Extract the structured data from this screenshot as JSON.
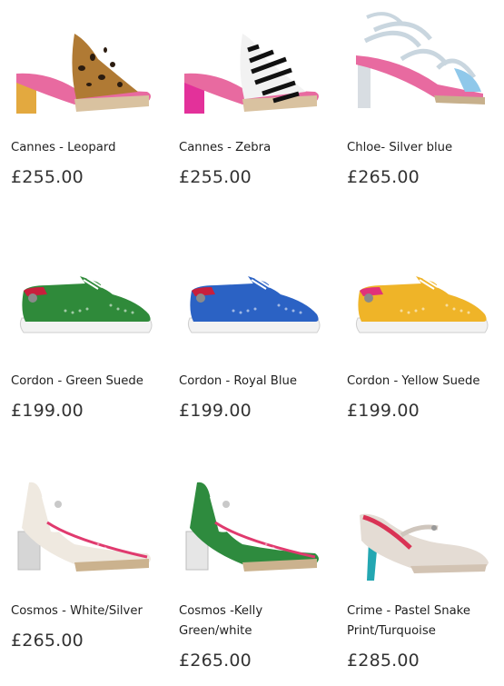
{
  "products": [
    {
      "name": "Cannes - Leopard",
      "price": "£255.00",
      "style": "mule-leopard",
      "colors": {
        "upper": "#b07a34",
        "spots": "#2b1c10",
        "heel": "#e0a02a",
        "lining": "#e86aa0",
        "sole": "#d9c2a0"
      }
    },
    {
      "name": "Cannes - Zebra",
      "price": "£255.00",
      "style": "mule-zebra",
      "colors": {
        "upper": "#f2f2f2",
        "stripes": "#111111",
        "heel": "#e01b8f",
        "lining": "#e86aa0",
        "sole": "#d9c2a0"
      }
    },
    {
      "name": "Chloe- Silver blue",
      "price": "£265.00",
      "style": "strappy-heel",
      "colors": {
        "upper": "#c9d6df",
        "accent": "#8fc8ea",
        "heel": "#d8dde2",
        "lining": "#e86aa0",
        "sole": "#c7b08c"
      }
    },
    {
      "name": "Cordon - Green Suede",
      "price": "£199.00",
      "style": "brogue",
      "colors": {
        "upper": "#2f8a3a",
        "sole": "#f2f2f2",
        "lining": "#c81f3c",
        "laces": "#ffffff"
      }
    },
    {
      "name": "Cordon - Royal Blue",
      "price": "£199.00",
      "style": "brogue",
      "colors": {
        "upper": "#2b62c4",
        "sole": "#f2f2f2",
        "lining": "#c81f3c",
        "laces": "#ffffff"
      }
    },
    {
      "name": "Cordon - Yellow Suede",
      "price": "£199.00",
      "style": "brogue",
      "colors": {
        "upper": "#efb428",
        "sole": "#f2f2f2",
        "lining": "#e0327a",
        "laces": "#ffffff"
      }
    },
    {
      "name": "Cosmos - White/Silver",
      "price": "£265.00",
      "style": "cutout-heel",
      "colors": {
        "upper": "#efe9e0",
        "heel": "#d6d6d6",
        "lining": "#e03a6e",
        "sole": "#cbb28e"
      }
    },
    {
      "name": "Cosmos -Kelly Green/white",
      "price": "£265.00",
      "style": "cutout-heel",
      "colors": {
        "upper": "#2e8b3e",
        "heel": "#e6e6e6",
        "lining": "#e03a6e",
        "sole": "#cbb28e"
      }
    },
    {
      "name": "Crime - Pastel Snake Print/Turquoise",
      "price": "£285.00",
      "style": "mary-jane",
      "colors": {
        "upper": "#e4dcd4",
        "heel": "#23a7b2",
        "lining": "#d93355",
        "sole": "#d2c3b3"
      }
    }
  ]
}
